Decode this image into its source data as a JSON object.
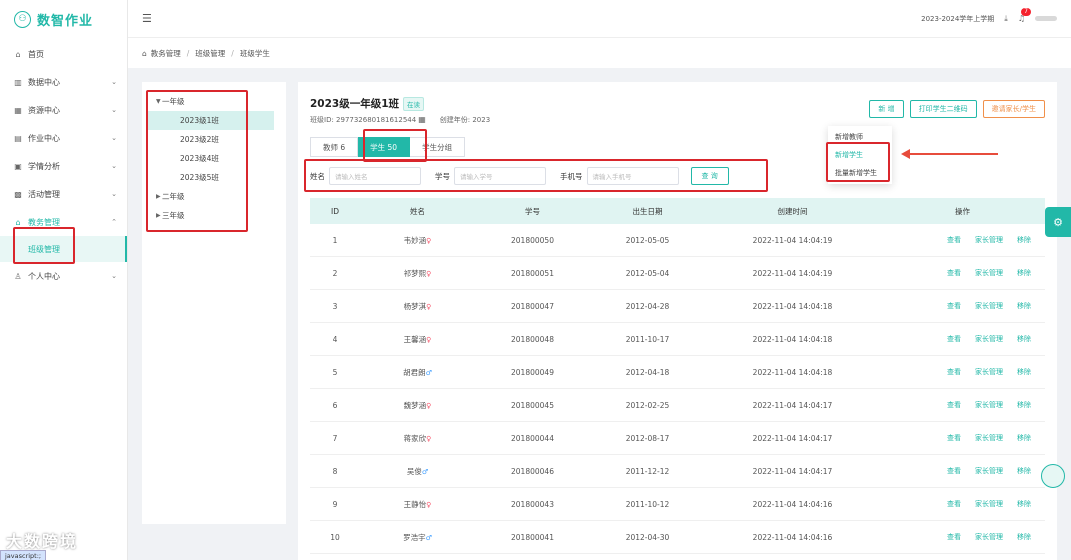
{
  "app": {
    "logo_mark": "⚇",
    "logo_text": "数智作业"
  },
  "sidebar": {
    "items": [
      {
        "icon": "home-icon",
        "glyph": "⌂",
        "label": "首页",
        "arrow": ""
      },
      {
        "icon": "chart-icon",
        "glyph": "▥",
        "label": "数据中心",
        "arrow": "⌄"
      },
      {
        "icon": "grid-icon",
        "glyph": "▦",
        "label": "资源中心",
        "arrow": "⌄"
      },
      {
        "icon": "homework-icon",
        "glyph": "▤",
        "label": "作业中心",
        "arrow": "⌄"
      },
      {
        "icon": "analysis-icon",
        "glyph": "▣",
        "label": "学情分析",
        "arrow": "⌄"
      },
      {
        "icon": "activity-icon",
        "glyph": "▩",
        "label": "活动管理",
        "arrow": "⌄"
      },
      {
        "icon": "academic-icon",
        "glyph": "⌂",
        "label": "教务管理",
        "arrow": "⌃"
      }
    ],
    "sub_active": "班级管理",
    "personal": {
      "glyph": "♙",
      "label": "个人中心",
      "arrow": "⌄"
    }
  },
  "header": {
    "term": "2023-2024学年上学期",
    "download_glyph": "⤓",
    "bell_glyph": "♫",
    "badge": "7"
  },
  "breadcrumb": [
    "教务管理",
    "班级管理",
    "班级学生"
  ],
  "tree": {
    "grade1": "一年级",
    "classes": [
      "2023级1班",
      "2023级2班",
      "2023级4班",
      "2023级5班"
    ],
    "grade2": "二年级",
    "grade3": "三年级"
  },
  "class_info": {
    "title": "2023级一年级1班",
    "status": "在读",
    "id_text": "班级ID: 297732680181612544",
    "year_text": "创建年份: 2023"
  },
  "tabs": [
    "教师 6",
    "学生 50",
    "学生分组"
  ],
  "filters": {
    "name_label": "姓名",
    "name_ph": "请输入姓名",
    "sno_label": "学号",
    "sno_ph": "请输入学号",
    "phone_label": "手机号",
    "phone_ph": "请输入手机号",
    "query": "查 询"
  },
  "actions": {
    "add": "新 增",
    "print": "打印学生二维码",
    "invite": "邀请家长/学生"
  },
  "dropdown": [
    "新增教师",
    "新增学生",
    "批量新增学生"
  ],
  "table": {
    "headers": [
      "ID",
      "姓名",
      "学号",
      "出生日期",
      "创建时间",
      "操作"
    ],
    "op_view": "查看",
    "op_parent": "家长管理",
    "op_remove": "移除",
    "rows": [
      {
        "id": "1",
        "name": "韦妙涵",
        "g": "♀",
        "sno": "201800050",
        "dob": "2012-05-05",
        "created": "2022-11-04 14:04:19"
      },
      {
        "id": "2",
        "name": "祁梦熙",
        "g": "♀",
        "sno": "201800051",
        "dob": "2012-05-04",
        "created": "2022-11-04 14:04:19"
      },
      {
        "id": "3",
        "name": "杨梦淇",
        "g": "♀",
        "sno": "201800047",
        "dob": "2012-04-28",
        "created": "2022-11-04 14:04:18"
      },
      {
        "id": "4",
        "name": "王馨涵",
        "g": "♀",
        "sno": "201800048",
        "dob": "2011-10-17",
        "created": "2022-11-04 14:04:18"
      },
      {
        "id": "5",
        "name": "胡君朗",
        "g": "♂",
        "sno": "201800049",
        "dob": "2012-04-18",
        "created": "2022-11-04 14:04:18"
      },
      {
        "id": "6",
        "name": "魏梦涵",
        "g": "♀",
        "sno": "201800045",
        "dob": "2012-02-25",
        "created": "2022-11-04 14:04:17"
      },
      {
        "id": "7",
        "name": "蒋家欣",
        "g": "♀",
        "sno": "201800044",
        "dob": "2012-08-17",
        "created": "2022-11-04 14:04:17"
      },
      {
        "id": "8",
        "name": "吴俊",
        "g": "♂",
        "sno": "201800046",
        "dob": "2011-12-12",
        "created": "2022-11-04 14:04:17"
      },
      {
        "id": "9",
        "name": "王静怡",
        "g": "♀",
        "sno": "201800043",
        "dob": "2011-10-12",
        "created": "2022-11-04 14:04:16"
      },
      {
        "id": "10",
        "name": "罗浩宇",
        "g": "♂",
        "sno": "201800041",
        "dob": "2012-04-30",
        "created": "2022-11-04 14:04:16"
      }
    ]
  },
  "watermark": "大数跨境",
  "statusbar": "javascript:;",
  "colors": {
    "accent": "#22b8a8",
    "highlight": "#d9262c",
    "orange": "#f0904a"
  }
}
